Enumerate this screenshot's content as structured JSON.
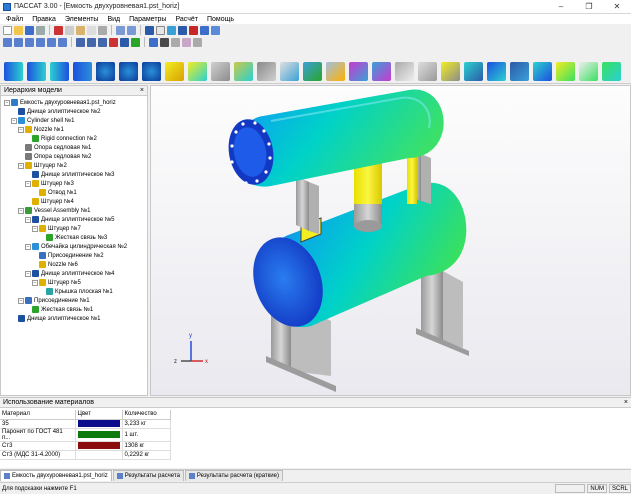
{
  "window": {
    "title": "ПАССАТ 3.00 - [Емкость двухуровневая1.pst_horiz]",
    "minimize": "–",
    "maximize": "❐",
    "close": "✕"
  },
  "menu": [
    "Файл",
    "Правка",
    "Элементы",
    "Вид",
    "Параметры",
    "Расчёт",
    "Помощь"
  ],
  "model_panel": {
    "title": "Иерархия модели",
    "close": "×",
    "tree": [
      {
        "label": "Емкость двухуровневая1.pst_horiz",
        "level": 0,
        "expanded": true,
        "icon": "vessel-icon",
        "color": "#2d7cc8"
      },
      {
        "label": "Днище эллиптическое №2",
        "level": 1,
        "expanded": null,
        "icon": "elliptic-head-icon",
        "color": "#1e4fa0"
      },
      {
        "label": "Cylinder shell №1",
        "level": 1,
        "expanded": true,
        "icon": "cylinder-icon",
        "color": "#2b8fd8"
      },
      {
        "label": "Nozzle №1",
        "level": 2,
        "expanded": true,
        "icon": "nozzle-icon",
        "color": "#e0b000"
      },
      {
        "label": "Rigid connection №2",
        "level": 3,
        "expanded": null,
        "icon": "rigid-connection-icon",
        "color": "#2aa52a"
      },
      {
        "label": "Опора седловая №1",
        "level": 2,
        "expanded": null,
        "icon": "saddle-support-icon",
        "color": "#7a7a7a"
      },
      {
        "label": "Опора седловая №2",
        "level": 2,
        "expanded": null,
        "icon": "saddle-support-icon",
        "color": "#7a7a7a"
      },
      {
        "label": "Штуцер №2",
        "level": 2,
        "expanded": true,
        "icon": "nozzle-icon",
        "color": "#e0b000"
      },
      {
        "label": "Днище эллиптическое №3",
        "level": 3,
        "expanded": null,
        "icon": "elliptic-head-icon",
        "color": "#1e4fa0"
      },
      {
        "label": "Штуцер №3",
        "level": 3,
        "expanded": true,
        "icon": "nozzle-icon",
        "color": "#e0b000"
      },
      {
        "label": "Отвод №1",
        "level": 4,
        "expanded": null,
        "icon": "elbow-icon",
        "color": "#e0b000"
      },
      {
        "label": "Штуцер №4",
        "level": 3,
        "expanded": null,
        "icon": "nozzle-icon",
        "color": "#e0b000"
      },
      {
        "label": "Vessel Assembly №1",
        "level": 2,
        "expanded": true,
        "icon": "assembly-icon",
        "color": "#3c9a3c"
      },
      {
        "label": "Днище эллиптическое №5",
        "level": 3,
        "expanded": true,
        "icon": "elliptic-head-icon",
        "color": "#1e4fa0"
      },
      {
        "label": "Штуцер №7",
        "level": 4,
        "expanded": true,
        "icon": "nozzle-icon",
        "color": "#e0b000"
      },
      {
        "label": "Жесткая связь №3",
        "level": 5,
        "expanded": null,
        "icon": "rigid-connection-icon",
        "color": "#2aa52a"
      },
      {
        "label": "Обечайка цилиндрическая №2",
        "level": 3,
        "expanded": true,
        "icon": "cylinder-icon",
        "color": "#2b8fd8"
      },
      {
        "label": "Присоединение №2",
        "level": 4,
        "expanded": null,
        "icon": "attachment-icon",
        "color": "#3a6fc0"
      },
      {
        "label": "Nozzle №6",
        "level": 4,
        "expanded": null,
        "icon": "nozzle-icon",
        "color": "#e0b000"
      },
      {
        "label": "Днище эллиптическое №4",
        "level": 3,
        "expanded": true,
        "icon": "elliptic-head-icon",
        "color": "#1e4fa0"
      },
      {
        "label": "Штуцер №5",
        "level": 4,
        "expanded": true,
        "icon": "nozzle-icon",
        "color": "#e0b000"
      },
      {
        "label": "Крышка плоская №1",
        "level": 5,
        "expanded": null,
        "icon": "flat-cover-icon",
        "color": "#2aa5a5"
      },
      {
        "label": "Присоединение №1",
        "level": 2,
        "expanded": true,
        "icon": "attachment-icon",
        "color": "#3a6fc0"
      },
      {
        "label": "Жесткая связь №1",
        "level": 3,
        "expanded": null,
        "icon": "rigid-connection-icon",
        "color": "#2aa52a"
      },
      {
        "label": "Днище эллиптическое №1",
        "level": 1,
        "expanded": null,
        "icon": "elliptic-head-icon",
        "color": "#1e4fa0"
      }
    ]
  },
  "materials_panel": {
    "title": "Использование материалов",
    "close": "×",
    "columns": [
      "Материал",
      "Цвет",
      "Количество"
    ],
    "rows": [
      {
        "material": "35",
        "color": "#0b0b8c",
        "amount": "3,233 кг"
      },
      {
        "material": "Паронит по ГОСТ 481 п...",
        "color": "#0d7a0d",
        "amount": "1 шт."
      },
      {
        "material": "Ст3",
        "color": "#8c0d0d",
        "amount": "1308 кг"
      },
      {
        "material": "Ст3 (МДС 31-4.2000)",
        "color": "",
        "amount": "0,2292 кг"
      }
    ]
  },
  "tabs": [
    "Емкость двухуровневая1.pst_horiz",
    "Результаты расчета",
    "Результаты расчета (краткие)"
  ],
  "status": {
    "message": "Для подсказки нажмите F1",
    "cells": [
      "",
      "NUM",
      "SCRL"
    ]
  },
  "axes": {
    "y": "y",
    "x": "x",
    "z": "z"
  },
  "colors": {
    "shell_start": "#1d4fe0",
    "shell_mid": "#00d2c8",
    "shell_end": "#38e060",
    "nozzle": "#f2ee22",
    "support": "#c8c8c8"
  }
}
